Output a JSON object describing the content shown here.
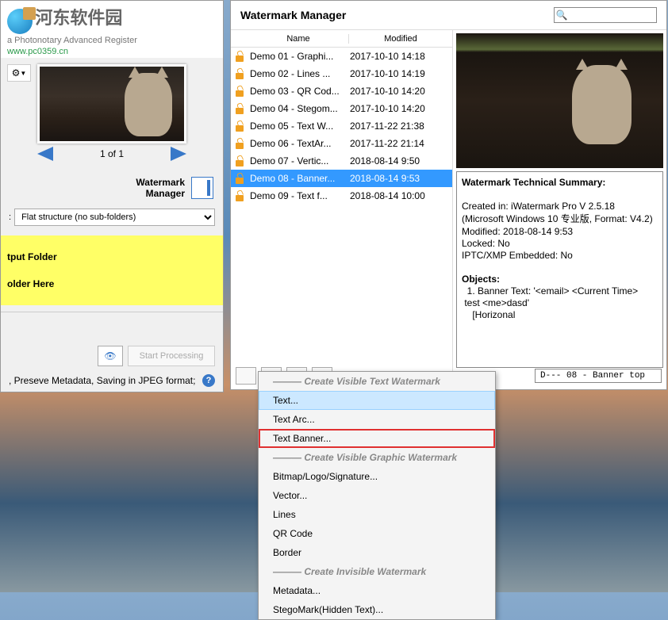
{
  "logo": {
    "name": "河东软件园",
    "menu": "a   Photonotary   Advanced   Register",
    "url": "www.pc0359.cn"
  },
  "thumb": {
    "counter": "1 of 1"
  },
  "watermark_manager_label": {
    "line1": "Watermark",
    "line2": "Manager"
  },
  "structure_dropdown": "Flat structure (no sub-folders)",
  "yellow": {
    "line1": "tput Folder",
    "line2": "older Here"
  },
  "start_button": "Start Processing",
  "status_text": ", Preseve Metadata, Saving in JPEG format;",
  "panel": {
    "title": "Watermark Manager",
    "columns": {
      "name": "Name",
      "modified": "Modified"
    }
  },
  "watermarks": [
    {
      "name": "Demo 01 - Graphi...",
      "modified": "2017-10-10 14:18"
    },
    {
      "name": "Demo 02 - Lines ...",
      "modified": "2017-10-10 14:19"
    },
    {
      "name": "Demo 03 - QR Cod...",
      "modified": "2017-10-10 14:20"
    },
    {
      "name": "Demo 04 - Stegom...",
      "modified": "2017-10-10 14:20"
    },
    {
      "name": "Demo 05 - Text W...",
      "modified": "2017-11-22 21:38"
    },
    {
      "name": "Demo 06 - TextAr...",
      "modified": "2017-11-22 21:14"
    },
    {
      "name": "Demo 07 - Vertic...",
      "modified": "2018-08-14 9:50"
    },
    {
      "name": "Demo 08 - Banner...",
      "modified": "2018-08-14 9:53"
    },
    {
      "name": "Demo 09 - Text f...",
      "modified": "2018-08-14 10:00"
    }
  ],
  "selected_index": 7,
  "summary": {
    "title": "Watermark Technical Summary:",
    "created_in": "Created in: iWatermark Pro V 2.5.18 (Microsoft Windows 10 专业版, Format: V4.2)",
    "modified": "Modified: 2018-08-14 9:53",
    "locked": "Locked: No",
    "embedded": "IPTC/XMP Embedded: No",
    "objects_title": "Objects:",
    "obj1": "  1. Banner Text: '<email> <Current Time>",
    "obj2": " test <me>dasd'",
    "obj3": "    [Horizonal"
  },
  "bottom_label": "D--- 08 - Banner top",
  "menu": {
    "h1": "Create Visible Text Watermark",
    "text": "Text...",
    "text_arc": "Text Arc...",
    "text_banner": "Text Banner...",
    "h2": "Create Visible Graphic Watermark",
    "bitmap": "Bitmap/Logo/Signature...",
    "vector": "Vector...",
    "lines": "Lines",
    "qr": "QR Code",
    "border": "Border",
    "h3": "Create Invisible Watermark",
    "metadata": "Metadata...",
    "stego": "StegoMark(Hidden Text)..."
  }
}
